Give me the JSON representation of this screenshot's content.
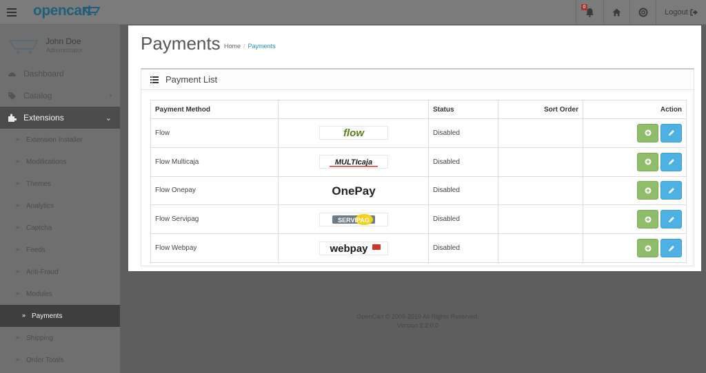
{
  "header": {
    "logo": "opencart",
    "notification_count": "0",
    "logout_label": "Logout"
  },
  "user": {
    "name": "John Doe",
    "role": "Administrator"
  },
  "sidebar": {
    "nav": [
      {
        "label": "Dashboard",
        "icon": "dashboard-icon"
      },
      {
        "label": "Catalog",
        "icon": "tag-icon"
      },
      {
        "label": "Extensions",
        "icon": "puzzle-icon"
      }
    ],
    "extensions_sub": [
      "Extension Installer",
      "Modifications",
      "Themes",
      "Analytics",
      "Captcha",
      "Feeds",
      "Anti-Fraud",
      "Modules",
      "Payments",
      "Shipping",
      "Order Totals"
    ]
  },
  "page": {
    "title": "Payments",
    "breadcrumb": [
      {
        "label": "Home"
      },
      {
        "label": "Payments"
      }
    ]
  },
  "panel": {
    "title": "Payment List"
  },
  "table": {
    "columns": [
      "Payment Method",
      "",
      "Status",
      "Sort Order",
      "Action"
    ],
    "rows": [
      {
        "method": "Flow",
        "logo_text": "flow",
        "status": "Disabled",
        "sort_order": ""
      },
      {
        "method": "Flow Multicaja",
        "logo_text": "MULTIcaja",
        "status": "Disabled",
        "sort_order": ""
      },
      {
        "method": "Flow Onepay",
        "logo_text": "OnePay",
        "status": "Disabled",
        "sort_order": ""
      },
      {
        "method": "Flow Servipag",
        "logo_text": "SERVIPAG",
        "status": "Disabled",
        "sort_order": ""
      },
      {
        "method": "Flow Webpay",
        "logo_text": "webpay",
        "status": "Disabled",
        "sort_order": ""
      }
    ]
  },
  "footer": {
    "copyright": "OpenCart © 2009-2019 All Rights Reserved.",
    "version": "Version 2.2.0.0"
  },
  "colors": {
    "header_bg": "#7b7b7b",
    "sidebar_bg": "#6f6f6f",
    "active_nav": "#4b4b4b",
    "link": "#1e91cf",
    "install_button": "#8fbe6b",
    "edit_button": "#4eb1e4"
  }
}
